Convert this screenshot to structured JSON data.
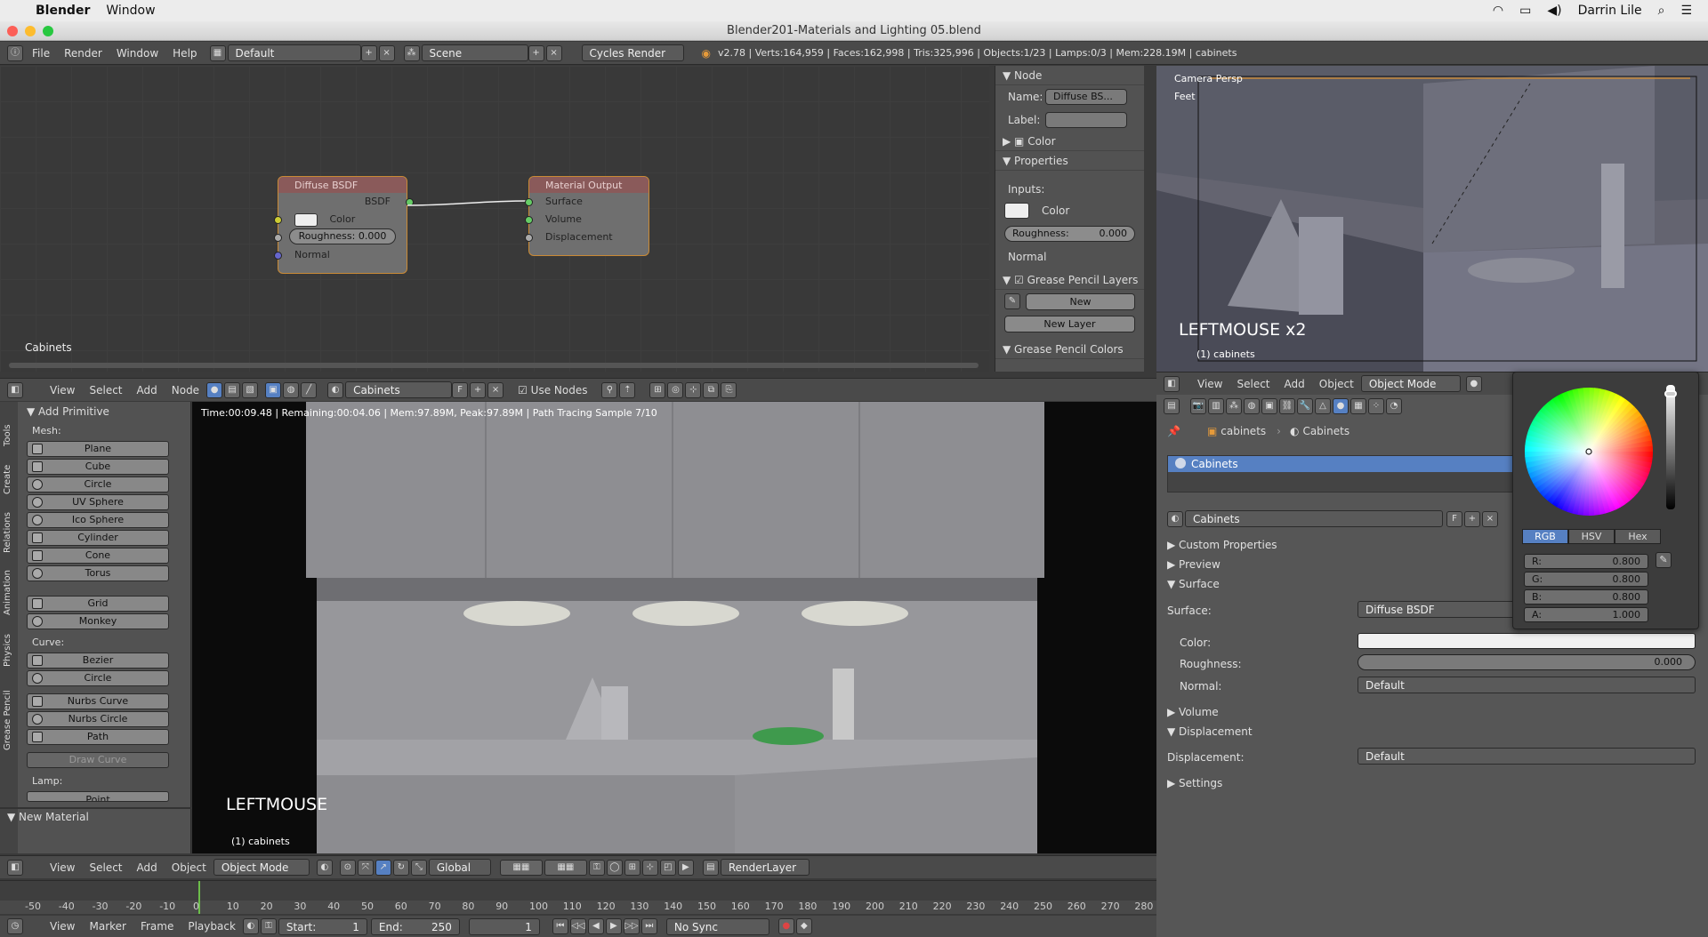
{
  "mac_menu": {
    "app": "Blender",
    "window": "Window",
    "user": "Darrin Lile"
  },
  "window_title": "Blender201-Materials and Lighting 05.blend",
  "info_header": {
    "menus": [
      "File",
      "Render",
      "Window",
      "Help"
    ],
    "layout": "Default",
    "scene": "Scene",
    "engine": "Cycles Render",
    "stats": "v2.78 | Verts:164,959 | Faces:162,998 | Tris:325,996 | Objects:1/23 | Lamps:0/3 | Mem:228.19M | cabinets"
  },
  "node_editor": {
    "diffuse": {
      "title": "Diffuse BSDF",
      "out": "BSDF",
      "color": "Color",
      "roughness": "Roughness: 0.000",
      "normal": "Normal"
    },
    "output": {
      "title": "Material Output",
      "surface": "Surface",
      "volume": "Volume",
      "displacement": "Displacement"
    },
    "material_label": "Cabinets"
  },
  "node_props": {
    "node_title": "Node",
    "name_label": "Name:",
    "name_value": "Diffuse BS...",
    "label_label": "Label:",
    "color_panel": "Color",
    "properties_panel": "Properties",
    "inputs": "Inputs:",
    "color": "Color",
    "roughness": "Roughness:",
    "roughness_val": "0.000",
    "normal": "Normal",
    "grease": "Grease Pencil Layers",
    "new": "New",
    "new_layer": "New Layer",
    "grease_colors": "Grease Pencil Colors"
  },
  "viewport": {
    "persp": "Camera Persp",
    "units": "Feet",
    "event": "LEFTMOUSE x2",
    "object": "(1) cabinets"
  },
  "node_header": {
    "menus": [
      "View",
      "Select",
      "Add",
      "Node"
    ],
    "material": "Cabinets",
    "f": "F",
    "use_nodes": "Use Nodes"
  },
  "tools": {
    "add_primitive": "Add Primitive",
    "mesh": "Mesh:",
    "mesh_items": [
      "Plane",
      "Cube",
      "Circle",
      "UV Sphere",
      "Ico Sphere",
      "Cylinder",
      "Cone",
      "Torus"
    ],
    "extra_items": [
      "Grid",
      "Monkey"
    ],
    "curve": "Curve:",
    "curve_items": [
      "Bezier",
      "Circle"
    ],
    "nurbs_items": [
      "Nurbs Curve",
      "Nurbs Circle",
      "Path"
    ],
    "draw_curve": "Draw Curve",
    "lamp": "Lamp:",
    "point": "Point",
    "new_material": "New Material",
    "tabs": [
      "Tools",
      "Create",
      "Relations",
      "Animation",
      "Physics",
      "Grease Pencil"
    ]
  },
  "render": {
    "stats": "Time:00:09.48 | Remaining:00:04.06 | Mem:97.89M, Peak:97.89M | Path Tracing Sample 7/10",
    "event": "LEFTMOUSE",
    "object": "(1) cabinets"
  },
  "bottom_header": {
    "menus": [
      "View",
      "Select",
      "Add",
      "Object"
    ],
    "mode": "Object Mode",
    "orientation": "Global",
    "layer": "RenderLayer"
  },
  "timeline": {
    "ticks": [
      "-50",
      "-40",
      "-30",
      "-20",
      "-10",
      "0",
      "10",
      "20",
      "30",
      "40",
      "50",
      "60",
      "70",
      "80",
      "90",
      "100",
      "110",
      "120",
      "130",
      "140",
      "150",
      "160",
      "170",
      "180",
      "190",
      "200",
      "210",
      "220",
      "230",
      "240",
      "250",
      "260",
      "270",
      "280"
    ],
    "menus": [
      "View",
      "Marker",
      "Frame",
      "Playback"
    ],
    "start": "Start:",
    "start_val": "1",
    "end": "End:",
    "end_val": "250",
    "current": "1",
    "sync": "No Sync"
  },
  "props_header": {
    "menus": [
      "View",
      "Select",
      "Add",
      "Object"
    ],
    "mode": "Object Mode"
  },
  "props": {
    "breadcrumb_obj": "cabinets",
    "breadcrumb_mat": "Cabinets",
    "slot": "Cabinets",
    "material_name": "Cabinets",
    "f": "F",
    "custom_props": "Custom Properties",
    "preview": "Preview",
    "surface_sec": "Surface",
    "surface_label": "Surface:",
    "surface_value": "Diffuse BSDF",
    "color_label": "Color:",
    "roughness_label": "Roughness:",
    "roughness_value": "0.000",
    "normal_label": "Normal:",
    "normal_value": "Default",
    "volume": "Volume",
    "displacement_sec": "Displacement",
    "displacement_label": "Displacement:",
    "displacement_value": "Default",
    "settings": "Settings"
  },
  "color_picker": {
    "tabs": [
      "RGB",
      "HSV",
      "Hex"
    ],
    "r": "R:",
    "r_val": "0.800",
    "g": "G:",
    "g_val": "0.800",
    "b": "B:",
    "b_val": "0.800",
    "a": "A:",
    "a_val": "1.000"
  },
  "colors": {
    "node_border": "#c98a35",
    "selected_slot": "#5680c2",
    "diffuse_header": "#8a5a5a",
    "output_header": "#8a5a5a"
  }
}
